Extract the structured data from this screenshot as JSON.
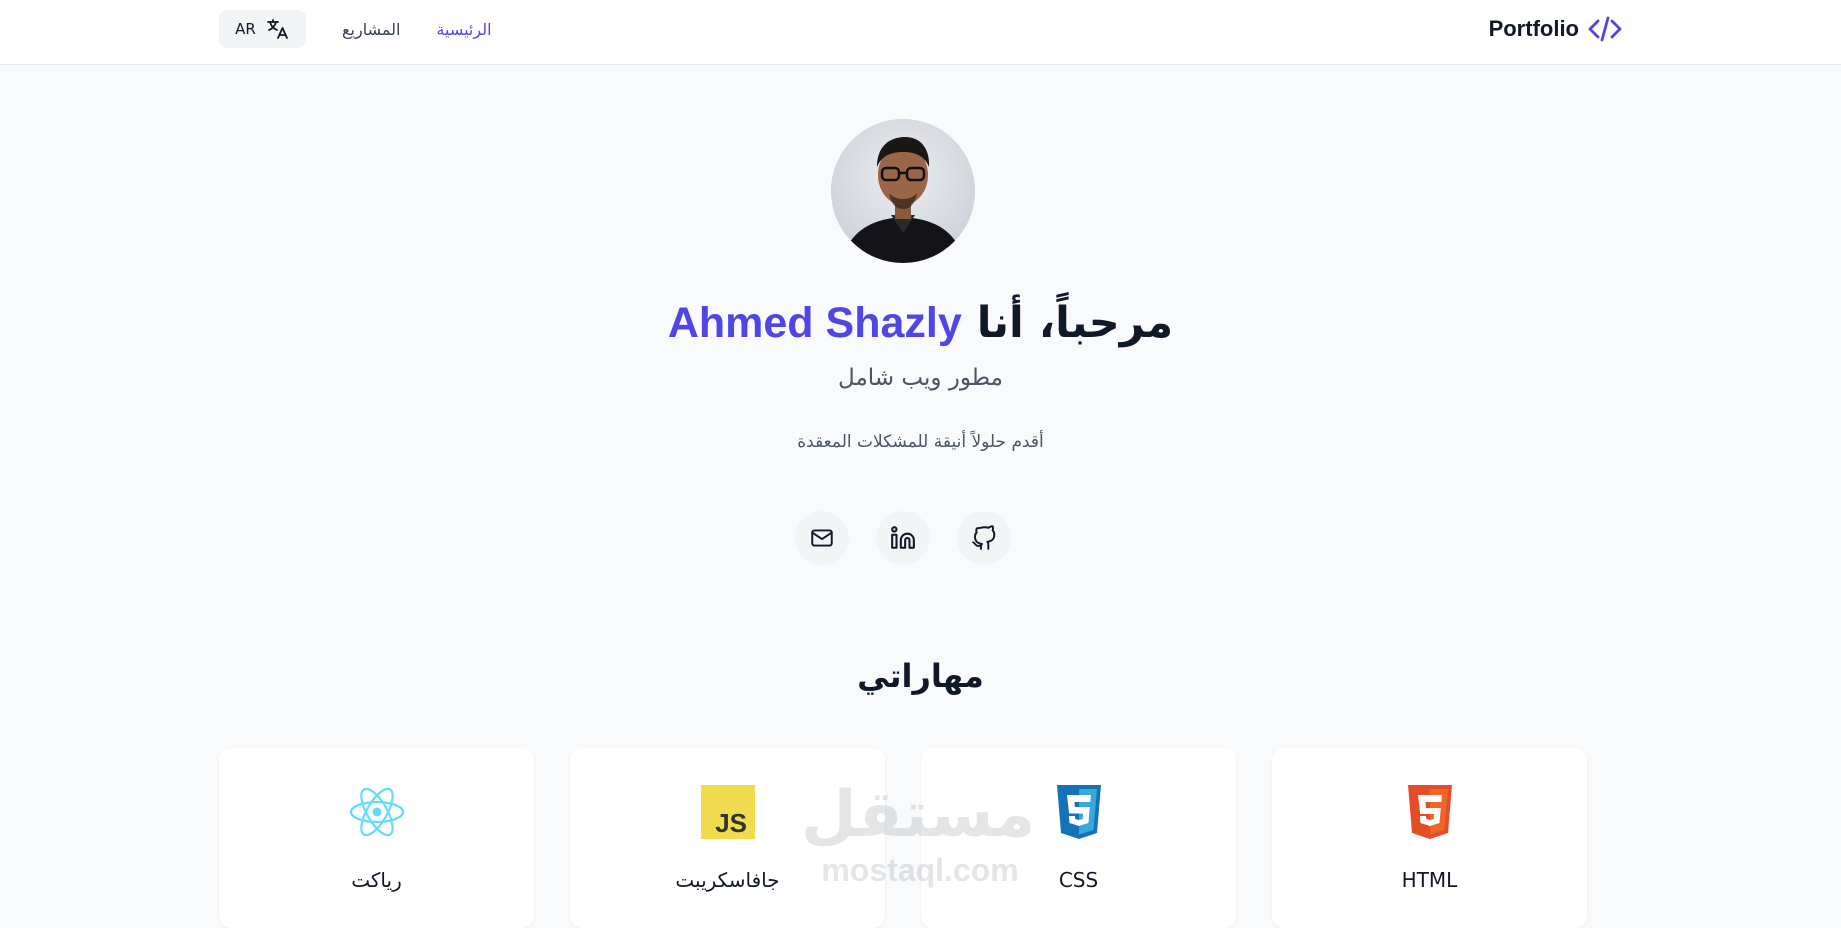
{
  "nav": {
    "brand": "Portfolio",
    "lang_label": "AR",
    "links": [
      "الرئيسية",
      "المشاريع"
    ]
  },
  "hero": {
    "greeting": "مرحباً، أنا",
    "name": "Ahmed Shazly",
    "subtitle": "مطور ويب شامل",
    "tagline": "أقدم حلولاً أنيقة للمشكلات المعقدة"
  },
  "skills": {
    "title": "مهاراتي",
    "items": [
      "HTML",
      "CSS",
      "جافاسكريبت",
      "رياكت"
    ],
    "js_badge": "JS"
  },
  "watermark": {
    "arabic": "مستقل",
    "latin": "mostaql.com"
  },
  "colors": {
    "accent": "#4f46e5",
    "html": "#e44d26",
    "css": "#1572b6",
    "js": "#f0db4f",
    "react": "#61dafb"
  },
  "icons": {
    "brand": "code-icon",
    "lang": "translate-icon",
    "socials": [
      "github-icon",
      "linkedin-icon",
      "mail-icon"
    ]
  }
}
